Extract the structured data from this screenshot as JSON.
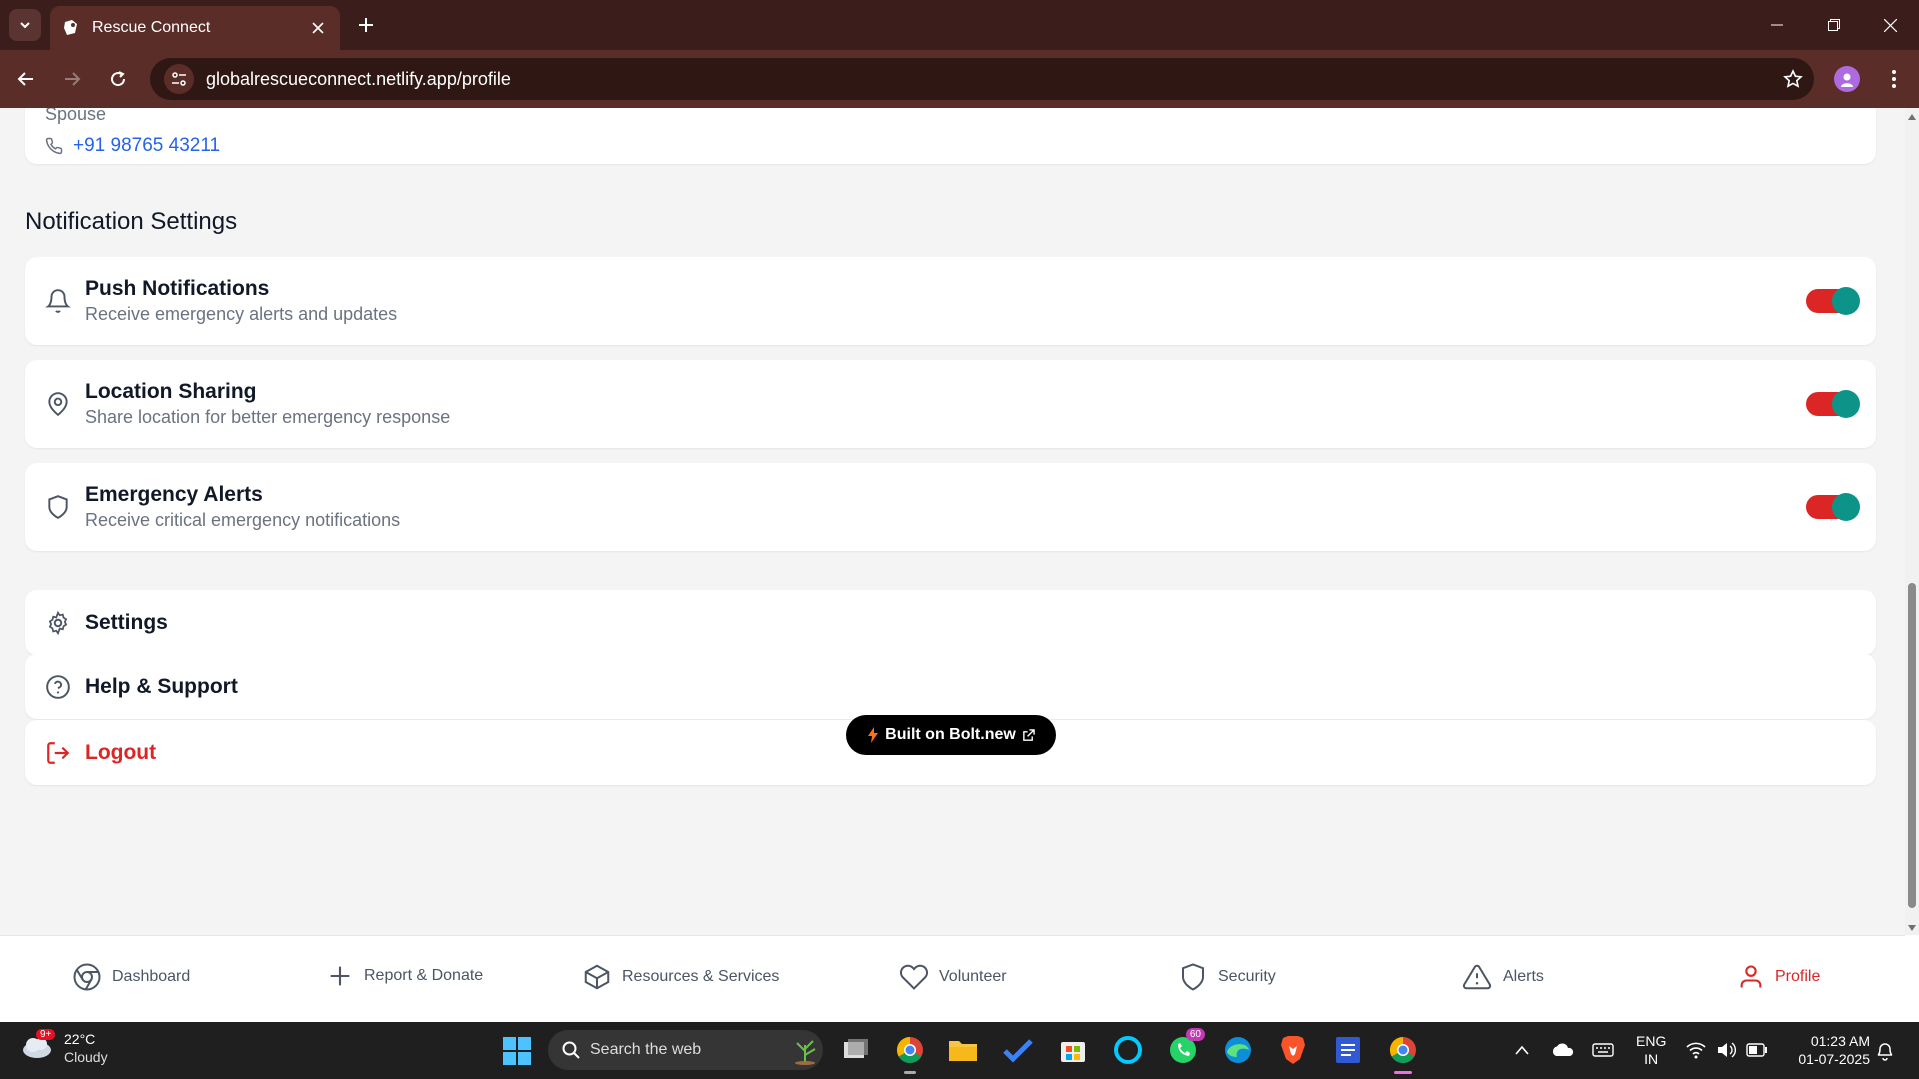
{
  "browser": {
    "tab_title": "Rescue Connect",
    "url": "globalrescueconnect.netlify.app/profile"
  },
  "contact": {
    "relation": "Spouse",
    "phone": "+91 98765 43211"
  },
  "notification_settings": {
    "title": "Notification Settings",
    "items": [
      {
        "icon": "bell-icon",
        "title": "Push Notifications",
        "description": "Receive emergency alerts and updates",
        "enabled": true
      },
      {
        "icon": "map-pin-icon",
        "title": "Location Sharing",
        "description": "Share location for better emergency response",
        "enabled": true
      },
      {
        "icon": "shield-icon",
        "title": "Emergency Alerts",
        "description": "Receive critical emergency notifications",
        "enabled": true
      }
    ]
  },
  "menu": {
    "settings": "Settings",
    "help": "Help & Support",
    "logout": "Logout"
  },
  "badge": {
    "label": "Built on Bolt.new"
  },
  "bottom_nav": {
    "items": [
      {
        "icon": "chrome-circle-icon",
        "label": "Dashboard"
      },
      {
        "icon": "plus-icon",
        "label": "Report & Donate"
      },
      {
        "icon": "box-icon",
        "label": "Resources & Services"
      },
      {
        "icon": "heart-icon",
        "label": "Volunteer"
      },
      {
        "icon": "shield-icon",
        "label": "Security"
      },
      {
        "icon": "alert-triangle-icon",
        "label": "Alerts"
      },
      {
        "icon": "user-icon",
        "label": "Profile",
        "active": true
      }
    ]
  },
  "taskbar": {
    "weather_temp": "22°C",
    "weather_condition": "Cloudy",
    "weather_badge": "9+",
    "search_placeholder": "Search the web",
    "whatsapp_badge": "60",
    "lang_line1": "ENG",
    "lang_line2": "IN",
    "time": "01:23 AM",
    "date": "01-07-2025"
  },
  "colors": {
    "accent_red": "#dc2626",
    "toggle_knob": "#0d9488",
    "link_blue": "#2563eb",
    "browser_frame": "#5a2d28"
  }
}
